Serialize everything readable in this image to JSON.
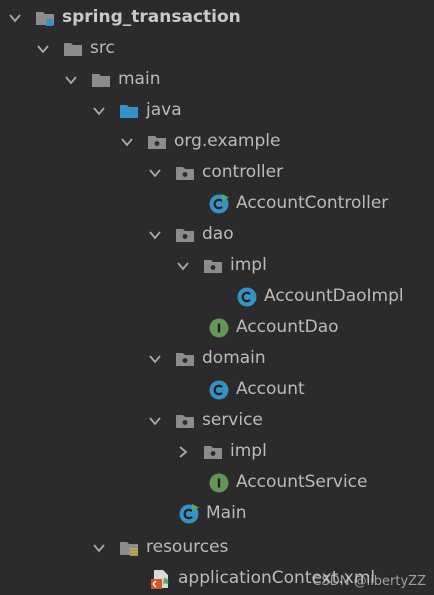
{
  "tree": {
    "root_label": "spring_transaction",
    "src_label": "src",
    "main_label": "main",
    "java_label": "java",
    "package_label": "org.example",
    "controller_label": "controller",
    "account_controller_label": "AccountController",
    "dao_label": "dao",
    "dao_impl_label": "impl",
    "account_dao_impl_label": "AccountDaoImpl",
    "account_dao_label": "AccountDao",
    "domain_label": "domain",
    "account_label": "Account",
    "service_label": "service",
    "service_impl_label": "impl",
    "account_service_label": "AccountService",
    "main_class_label": "Main",
    "resources_label": "resources",
    "app_context_label": "applicationContext.xml"
  },
  "watermark": "CSDN @libertyZZ",
  "colors": {
    "background": "#2b2b2b",
    "text": "#bbbbbb",
    "folder": "#8c8c8c",
    "source_folder": "#3592c4",
    "class_icon": "#3592c4",
    "interface_icon": "#629755",
    "run_marker": "#59a869"
  }
}
